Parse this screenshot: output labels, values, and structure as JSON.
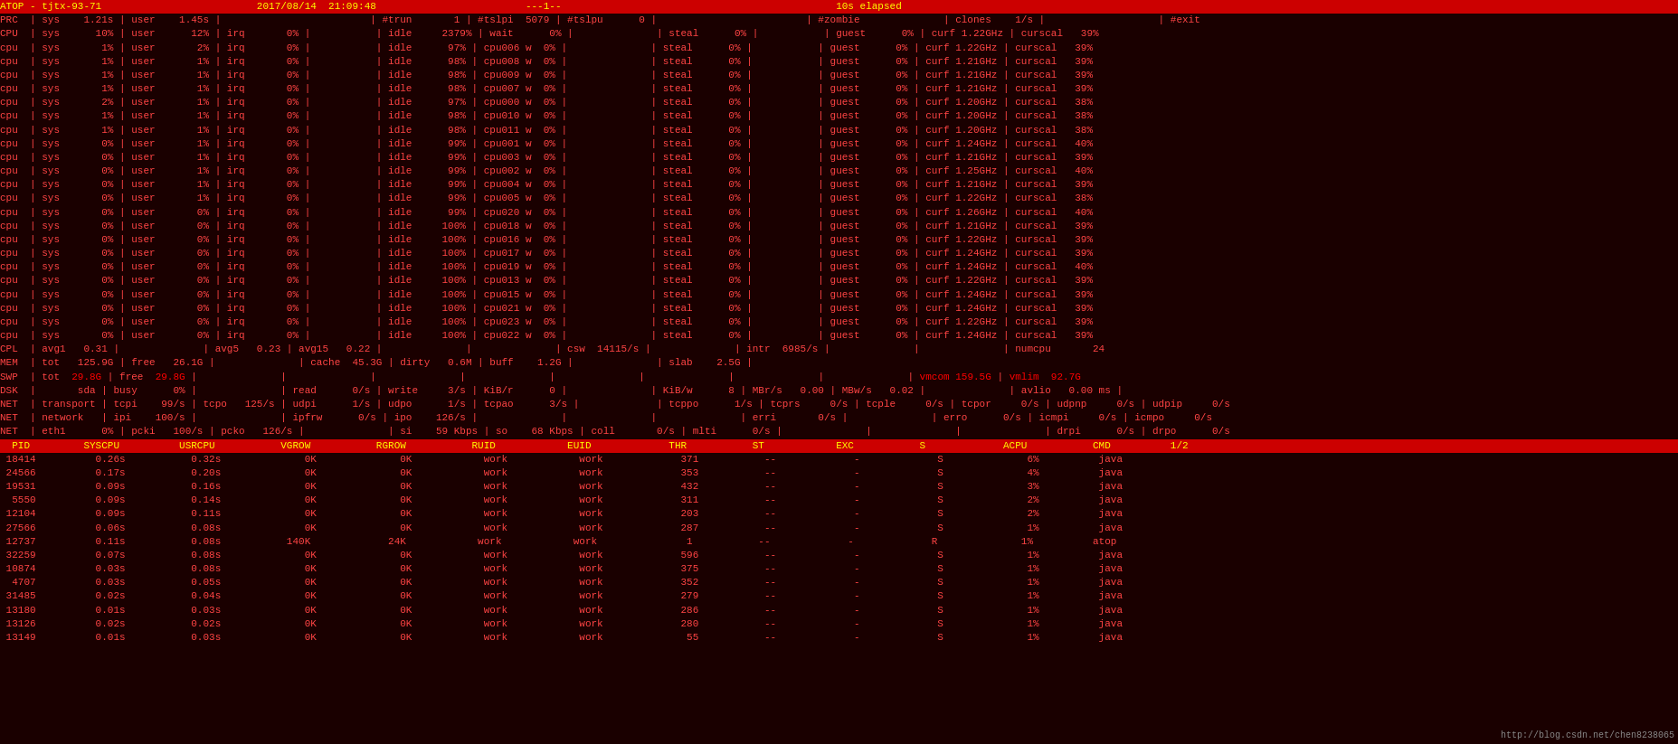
{
  "header": {
    "title": "ATOP - tjtx-93-71",
    "datetime": "2017/08/14  21:09:48",
    "indicator": "---1--",
    "elapsed": "10s elapsed"
  },
  "watermark": "http://blog.csdn.net/chen8238065"
}
